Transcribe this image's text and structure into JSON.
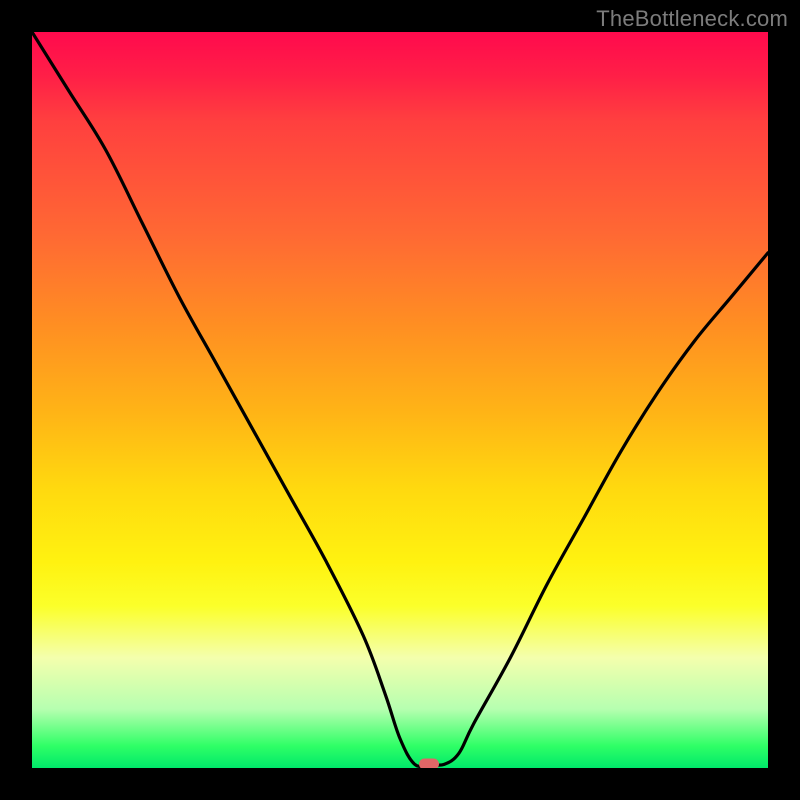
{
  "watermark": "TheBottleneck.com",
  "chart_data": {
    "type": "line",
    "title": "",
    "xlabel": "",
    "ylabel": "",
    "xlim": [
      0,
      100
    ],
    "ylim": [
      0,
      100
    ],
    "grid": false,
    "legend": false,
    "series": [
      {
        "name": "bottleneck-curve",
        "x": [
          0,
          5,
          10,
          15,
          20,
          25,
          30,
          35,
          40,
          45,
          48,
          50,
          52,
          54,
          56,
          58,
          60,
          65,
          70,
          75,
          80,
          85,
          90,
          95,
          100
        ],
        "y": [
          100,
          92,
          84,
          74,
          64,
          55,
          46,
          37,
          28,
          18,
          10,
          4,
          0.5,
          0.5,
          0.5,
          2,
          6,
          15,
          25,
          34,
          43,
          51,
          58,
          64,
          70
        ]
      }
    ],
    "marker": {
      "x": 54,
      "y": 0.5
    },
    "gradient_stops": [
      {
        "pos": 0,
        "color": "#ff0a4d"
      },
      {
        "pos": 50,
        "color": "#ffb516"
      },
      {
        "pos": 78,
        "color": "#fbff2a"
      },
      {
        "pos": 100,
        "color": "#00e86a"
      }
    ]
  }
}
